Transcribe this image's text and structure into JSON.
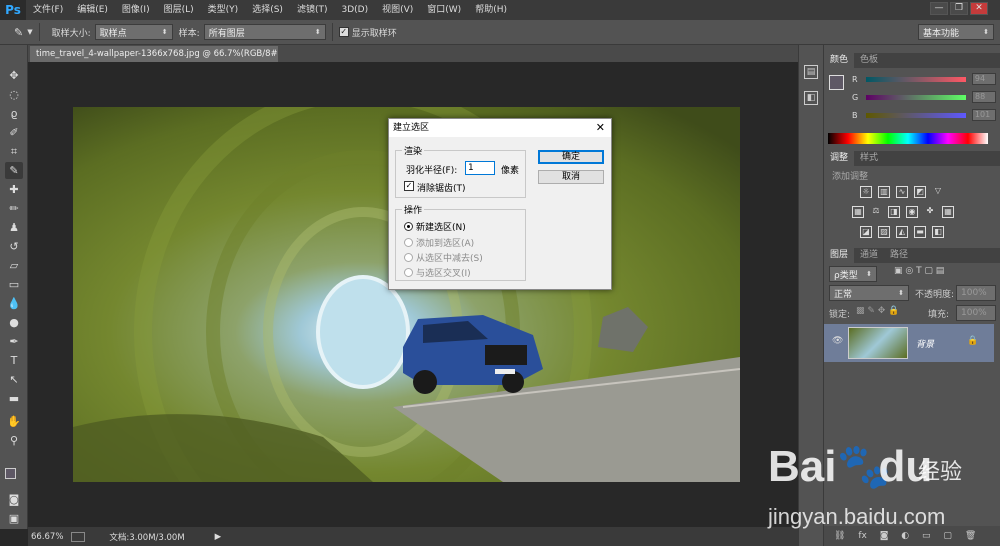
{
  "app": {
    "logo": "Ps"
  },
  "menu": [
    "文件(F)",
    "编辑(E)",
    "图像(I)",
    "图层(L)",
    "类型(Y)",
    "选择(S)",
    "滤镜(T)",
    "3D(D)",
    "视图(V)",
    "窗口(W)",
    "帮助(H)"
  ],
  "window_controls": {
    "minimize": "—",
    "restore": "❐",
    "close": "✕"
  },
  "options": {
    "sample_size_label": "取样大小:",
    "sample_size_value": "取样点",
    "sample_label": "样本:",
    "sample_value": "所有图层",
    "show_ring_label": "显示取样环",
    "show_ring_checked": true,
    "workspace": "基本功能"
  },
  "document": {
    "tab_title": "time_travel_4-wallpaper-1366x768.jpg @ 66.7%(RGB/8#) *",
    "close": "×"
  },
  "status": {
    "zoom": "66.67%",
    "doc_info": "文档:3.00M/3.00M"
  },
  "color_panel": {
    "tabs": [
      "颜色",
      "色板"
    ],
    "channels": [
      {
        "name": "R",
        "value": "94"
      },
      {
        "name": "G",
        "value": "88"
      },
      {
        "name": "B",
        "value": "101"
      }
    ],
    "colors": {
      "r_track": "#c44",
      "g_track": "#4a4",
      "b_track": "#44c"
    }
  },
  "adjust_panel": {
    "tabs": [
      "调整",
      "样式"
    ],
    "add_label": "添加调整"
  },
  "layers_panel": {
    "tabs": [
      "图层",
      "通道",
      "路径"
    ],
    "filter_kind": "ρ类型",
    "blend_mode": "正常",
    "opacity_label": "不透明度:",
    "opacity_value": "100%",
    "lock_label": "锁定:",
    "fill_label": "填充:",
    "fill_value": "100%",
    "layer_name": "背景"
  },
  "dialog": {
    "title": "建立选区",
    "close": "✕",
    "render_group": "渲染",
    "feather_label": "羽化半径(F):",
    "feather_value": "1",
    "feather_unit": "像素",
    "antialias_label": "消除锯齿(T)",
    "antialias_checked": true,
    "op_group": "操作",
    "ops": [
      "新建选区(N)",
      "添加到选区(A)",
      "从选区中减去(S)",
      "与选区交叉(I)"
    ],
    "ok": "确定",
    "cancel": "取消"
  },
  "watermark": {
    "brand": "Bai",
    "brand_tail": "du",
    "cn": "经验",
    "url": "jingyan.baidu.com"
  }
}
